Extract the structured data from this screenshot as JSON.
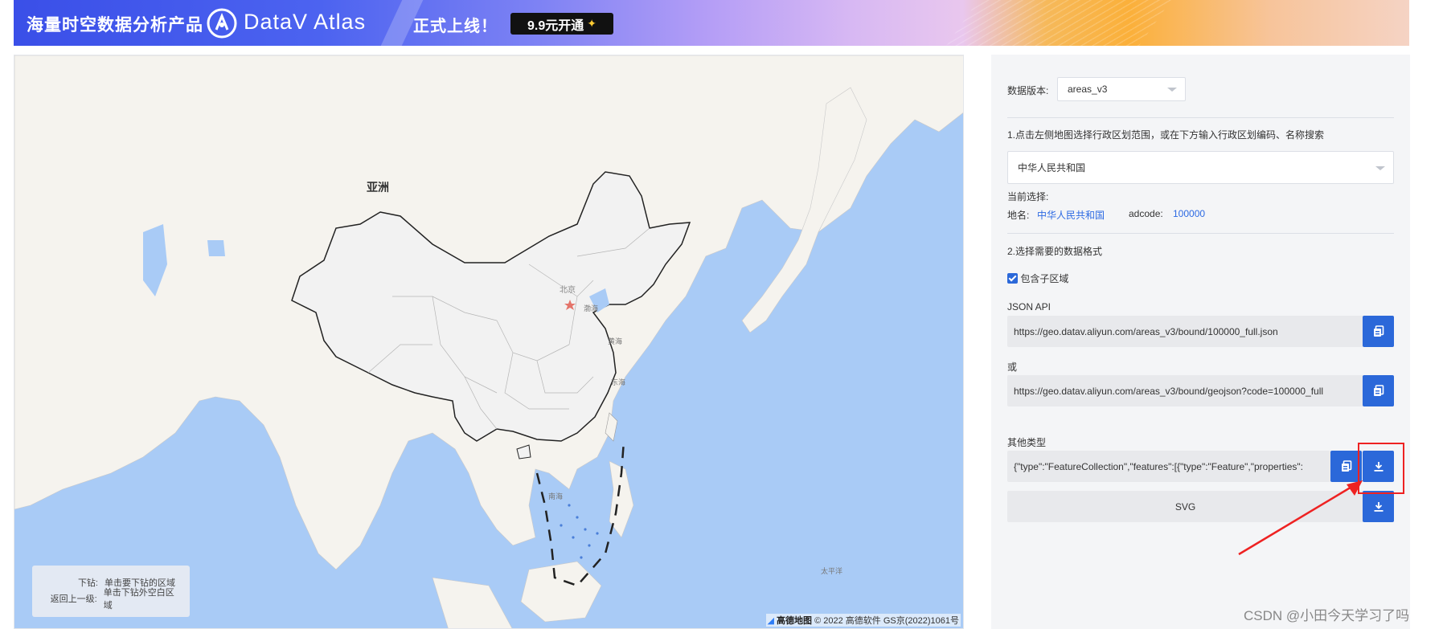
{
  "banner": {
    "title": "海量时空数据分析产品",
    "brand": "DataV Atlas",
    "launch": "正式上线！",
    "cta": "9.9元开通",
    "cta_icon": "sparkle-icon"
  },
  "map": {
    "label_asia": "亚洲",
    "label_beijing": "北京",
    "label_bohai": "渤海",
    "label_yellow_sea": "黄海",
    "label_east_sea": "东海",
    "label_south_sea": "南海",
    "label_pacific": "太平洋",
    "hint": {
      "drill_key": "下钻:",
      "drill_val": "单击要下钻的区域",
      "back_key": "返回上一级:",
      "back_val": "单击下钻外空白区域"
    },
    "attribution_brand": "高德地图",
    "attribution_text": "© 2022 高德软件 GS京(2022)1061号"
  },
  "panel": {
    "version_label": "数据版本:",
    "version_value": "areas_v3",
    "step1": "1.点击左侧地图选择行政区划范围，或在下方输入行政区划编码、名称搜索",
    "region_select": "中华人民共和国",
    "current_label": "当前选择:",
    "place_label": "地名:",
    "place_value": "中华人民共和国",
    "adcode_label": "adcode:",
    "adcode_value": "100000",
    "step2": "2.选择需要的数据格式",
    "include_sub": "包含子区域",
    "include_sub_checked": true,
    "json_api_label": "JSON API",
    "json_api_url": "https://geo.datav.aliyun.com/areas_v3/bound/100000_full.json",
    "or_label": "或",
    "geojson_url": "https://geo.datav.aliyun.com/areas_v3/bound/geojson?code=100000_full",
    "other_label": "其他类型",
    "other_value": "{\"type\":\"FeatureCollection\",\"features\":[{\"type\":\"Feature\",\"properties\":",
    "svg_label": "SVG"
  },
  "watermark": "CSDN @小田今天学习了吗",
  "colors": {
    "accent": "#2b68d9",
    "link": "#2d6ae3",
    "annotation": "#ee2222"
  }
}
